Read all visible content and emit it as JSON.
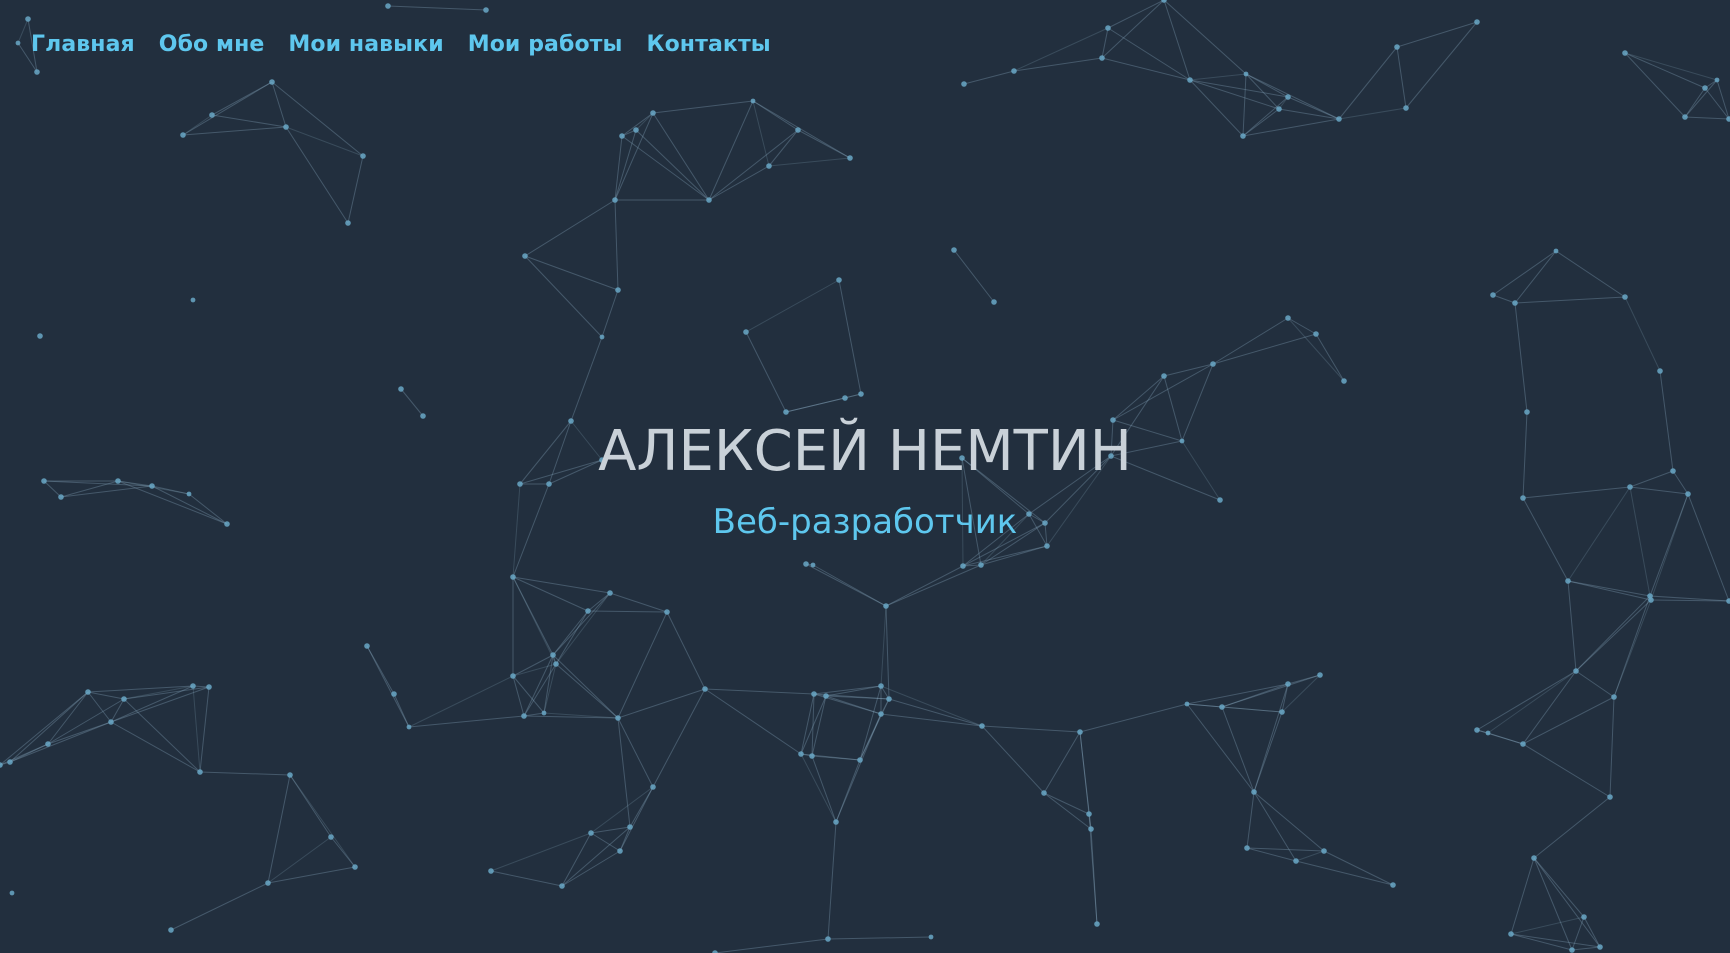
{
  "nav": {
    "items": [
      {
        "label": "Главная"
      },
      {
        "label": "Обо мне"
      },
      {
        "label": "Мои навыки"
      },
      {
        "label": "Мои работы"
      },
      {
        "label": "Контакты"
      }
    ]
  },
  "hero": {
    "title": "АЛЕКСЕЙ НЕМТИН",
    "subtitle": "Веб-разработчик"
  },
  "colors": {
    "background": "#222f3e",
    "accent": "#5ec7ee",
    "title": "#c9d1d8",
    "node": "#69a7c5",
    "line": "#8fb2c6"
  },
  "icons": {
    "background": "network-particles-graphic"
  }
}
